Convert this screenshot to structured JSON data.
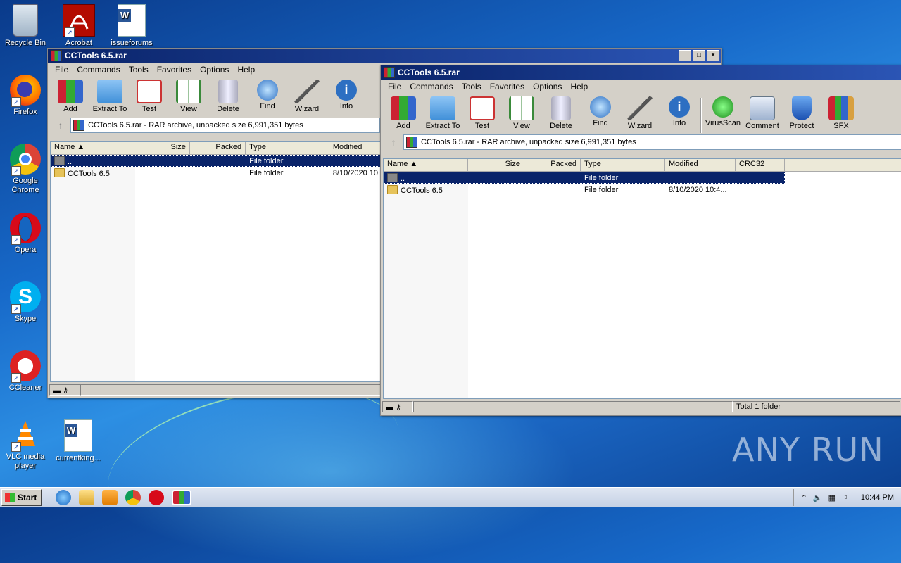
{
  "desktop": {
    "icons": [
      {
        "label": "Recycle Bin"
      },
      {
        "label": "Acrobat"
      },
      {
        "label": "issueforums"
      },
      {
        "label": "Firefox"
      },
      {
        "label": "Google Chrome"
      },
      {
        "label": "Opera"
      },
      {
        "label": "Skype"
      },
      {
        "label": "CCleaner"
      },
      {
        "label": "VLC media player"
      },
      {
        "label": "currentking..."
      }
    ],
    "watermark": "ANY RUN"
  },
  "windows": [
    {
      "title": "CCTools 6.5.rar",
      "menu": [
        "File",
        "Commands",
        "Tools",
        "Favorites",
        "Options",
        "Help"
      ],
      "toolbar": [
        "Add",
        "Extract To",
        "Test",
        "View",
        "Delete",
        "Find",
        "Wizard",
        "Info"
      ],
      "address": "CCTools 6.5.rar - RAR archive, unpacked size 6,991,351 bytes",
      "columns": [
        "Name",
        "Size",
        "Packed",
        "Type",
        "Modified"
      ],
      "rows": [
        {
          "name": "..",
          "size": "",
          "packed": "",
          "type": "File folder",
          "modified": ""
        },
        {
          "name": "CCTools 6.5",
          "size": "",
          "packed": "",
          "type": "File folder",
          "modified": "8/10/2020 10"
        }
      ],
      "status": ""
    },
    {
      "title": "CCTools 6.5.rar",
      "menu": [
        "File",
        "Commands",
        "Tools",
        "Favorites",
        "Options",
        "Help"
      ],
      "toolbar": [
        "Add",
        "Extract To",
        "Test",
        "View",
        "Delete",
        "Find",
        "Wizard",
        "Info",
        "VirusScan",
        "Comment",
        "Protect",
        "SFX"
      ],
      "address": "CCTools 6.5.rar - RAR archive, unpacked size 6,991,351 bytes",
      "columns": [
        "Name",
        "Size",
        "Packed",
        "Type",
        "Modified",
        "CRC32"
      ],
      "rows": [
        {
          "name": "..",
          "size": "",
          "packed": "",
          "type": "File folder",
          "modified": "",
          "crc": ""
        },
        {
          "name": "CCTools 6.5",
          "size": "",
          "packed": "",
          "type": "File folder",
          "modified": "8/10/2020 10:4...",
          "crc": ""
        }
      ],
      "status": "Total 1 folder"
    }
  ],
  "taskbar": {
    "start": "Start",
    "clock": "10:44 PM"
  },
  "colors": {
    "title_bar": "#0a246a",
    "selection": "#0a246a",
    "window_face": "#d4d0c8"
  }
}
